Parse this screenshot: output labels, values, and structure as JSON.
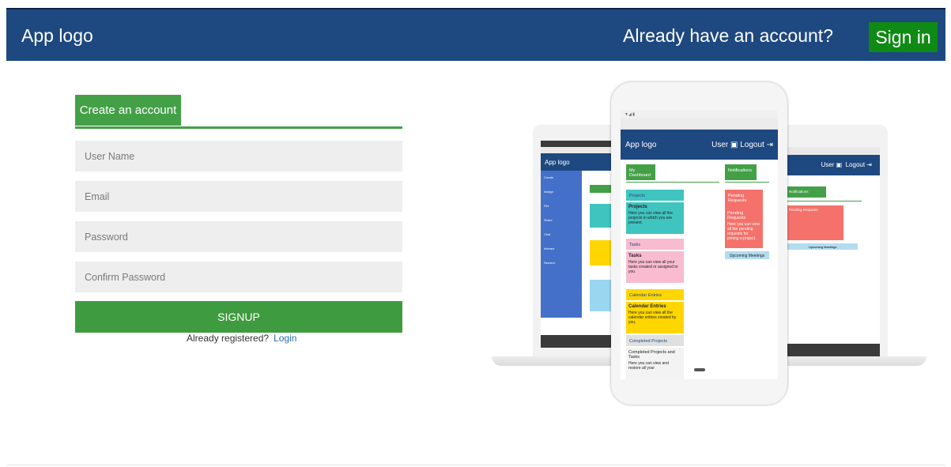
{
  "header": {
    "logo": "App logo",
    "have_account": "Already have an account?",
    "signin_label": "Sign in"
  },
  "form": {
    "tab_label": "Create an account",
    "username_placeholder": "User Name",
    "email_placeholder": "Email",
    "password_placeholder": "Password",
    "confirm_placeholder": "Confirm Password",
    "signup_label": "SIGNUP",
    "registered_text": "Already registered?",
    "login_label": "Login"
  },
  "preview": {
    "phone": {
      "logo": "App logo",
      "user": "User",
      "logout": "Logout",
      "dashboard": "My Dashboard",
      "notifications": "Notifications",
      "projects_tab": "Projects",
      "projects_title": "Projects",
      "projects_text": "Here you can view all the projects in which you are present.",
      "tasks_tab": "Tasks",
      "tasks_title": "Tasks",
      "tasks_text": "Here you can view all your tasks created or assigned to you.",
      "calendar_tab": "Calendar Entries",
      "calendar_title": "Calendar Entries",
      "calendar_text": "Here you can view all the calendar entries created by you.",
      "completed_tab": "Completed Projects",
      "completed_title": "Completed Projects and Tasks",
      "completed_text": "Here you can view and restore all your",
      "pending_tab": "Pending Requests",
      "pending_title": "Pending Requests",
      "pending_text": "Here you can view all the pending requests for joining a project.",
      "meetings": "Upcoming Meetings"
    },
    "laptop_left": {
      "logo": "App logo",
      "menu": [
        "Create",
        "Assign",
        "File",
        "Share",
        "Chat",
        "Interact",
        "Remind"
      ]
    },
    "laptop_right": {
      "user": "User",
      "logout": "Logout",
      "notifications": "Notifications",
      "pending": "Pending Requests",
      "meetings": "Upcoming Meetings"
    },
    "colors": {
      "teal": "#40c4c0",
      "pink": "#f8bbd0",
      "yellow": "#ffd600",
      "salmon": "#f4726b",
      "blue_header": "#1e4880",
      "green": "#43a047"
    }
  }
}
